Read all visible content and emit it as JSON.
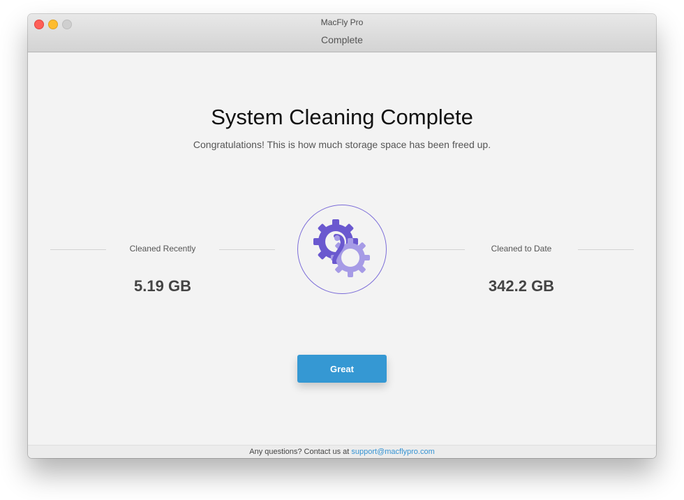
{
  "window": {
    "app_title": "MacFly Pro",
    "title": "Complete"
  },
  "main": {
    "headline": "System Cleaning Complete",
    "subheadline": "Congratulations! This is how much storage space has been freed up.",
    "stats": [
      {
        "label": "Cleaned Recently",
        "value": "5.19 GB"
      },
      {
        "label": "Cleaned to Date",
        "value": "342.2 GB"
      }
    ],
    "icon": "gears-icon",
    "primary_button": "Great"
  },
  "footer": {
    "text": "Any questions? Contact us at",
    "link": "support@macflypro.com"
  },
  "colors": {
    "accent_button": "#3598d3",
    "icon_primary": "#6a58cf",
    "icon_secondary": "#a69be6",
    "link": "#3593d3"
  }
}
